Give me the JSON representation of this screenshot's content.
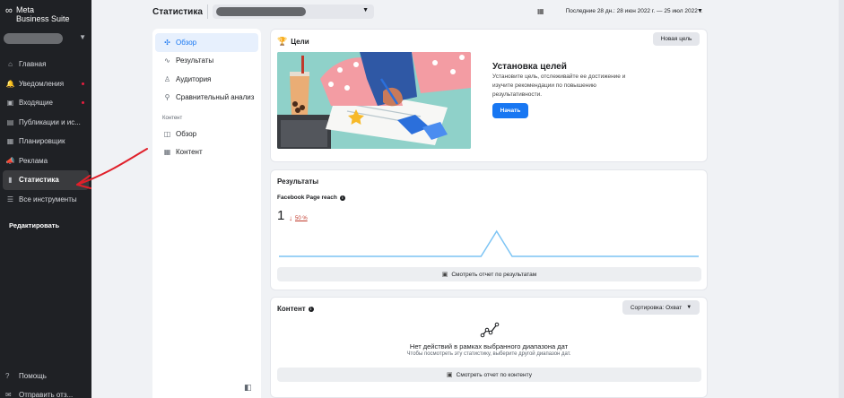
{
  "sidebar": {
    "logo_mark": "∞",
    "logo_line1": "Meta",
    "logo_line2": "Business Suite",
    "account_chevron": "▼",
    "items": [
      {
        "label": "Главная",
        "icon": "⌂"
      },
      {
        "label": "Уведомления",
        "icon": "🔔"
      },
      {
        "label": "Входящие",
        "icon": "▣"
      },
      {
        "label": "Публикации и ис...",
        "icon": "▤"
      },
      {
        "label": "Планировщик",
        "icon": "▦"
      },
      {
        "label": "Реклама",
        "icon": "📣"
      },
      {
        "label": "Статистика",
        "icon": "▮"
      },
      {
        "label": "Все инструменты",
        "icon": "☰"
      }
    ],
    "edit_label": "Редактировать",
    "help_label": "Помощь",
    "help_icon": "?",
    "send_label": "Отправить отз...",
    "send_icon": "✉"
  },
  "header": {
    "title": "Статистика",
    "page_chevron": "▼",
    "date_icon": "▦",
    "date_range": "Последние 28 дн.: 28 июн 2022 г. — 25 июл 2022 г.",
    "date_chevron": "▼"
  },
  "subnav": {
    "items": [
      {
        "label": "Обзор",
        "icon": "✣"
      },
      {
        "label": "Результаты",
        "icon": "∿"
      },
      {
        "label": "Аудитория",
        "icon": "♙"
      },
      {
        "label": "Сравнительный анализ",
        "icon": "⚲"
      }
    ],
    "section_label": "Контент",
    "content_items": [
      {
        "label": "Обзор",
        "icon": "◫"
      },
      {
        "label": "Контент",
        "icon": "▦"
      }
    ],
    "collapse_icon": "◧"
  },
  "goals": {
    "title": "Цели",
    "trophy_icon": "🏆",
    "new_goal_label": "Новая цель",
    "heading": "Установка целей",
    "description": "Установите цель, отслеживайте ее достижение и изучите рекомендации по повышению результативности.",
    "start_label": "Начать"
  },
  "results": {
    "title": "Результаты",
    "metric_name": "Facebook Page reach",
    "info_glyph": "i",
    "metric_value": "1",
    "change_arrow": "↓",
    "change_pct": "50 %",
    "button_icon": "▣",
    "button_label": "Смотреть отчет по результатам",
    "sparkline": {
      "points": [
        0,
        0,
        0,
        0,
        0,
        0,
        0,
        0,
        0,
        0,
        0,
        0,
        0,
        0,
        1,
        0,
        0,
        0,
        0,
        0,
        0,
        0,
        0,
        0,
        0,
        0,
        0,
        0
      ],
      "color": "#7cc4f4"
    }
  },
  "content": {
    "title": "Контент",
    "info_glyph": "i",
    "sort_label": "Сортировка: Охват",
    "sort_chevron": "▼",
    "empty_title": "Нет действий в рамках выбранного диапазона дат",
    "empty_sub": "Чтобы посмотреть эту статистику, выберите другой диапазон дат.",
    "button_icon": "▣",
    "button_label": "Смотреть отчет по контенту"
  },
  "colors": {
    "accent": "#1877f2",
    "negative": "#c0392b",
    "annotation_arrow": "#e0202a"
  }
}
